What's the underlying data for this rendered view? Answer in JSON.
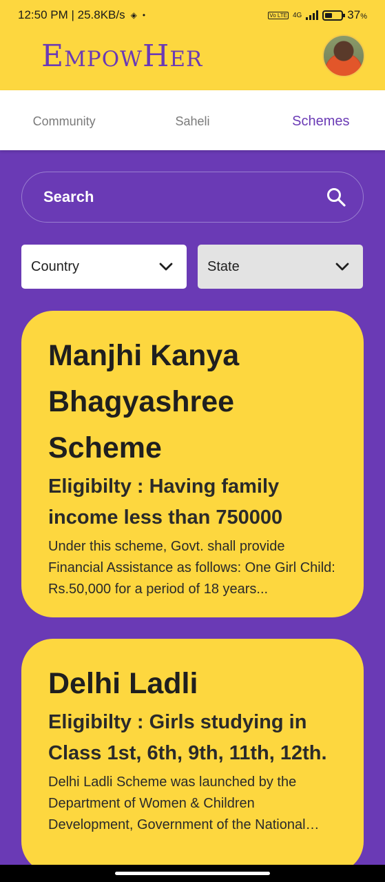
{
  "status": {
    "time_speed": "12:50 PM | 25.8KB/s",
    "battery": "37",
    "battery_unit": "%",
    "network": "4G",
    "volte": "Vo LTE"
  },
  "app": {
    "logo": "EmpowHer"
  },
  "tabs": [
    {
      "label": "Community"
    },
    {
      "label": "Saheli"
    },
    {
      "label": "Schemes"
    }
  ],
  "search": {
    "label": "Search"
  },
  "filters": {
    "country": "Country",
    "state": "State"
  },
  "schemes": [
    {
      "title": "Manjhi Kanya Bhagyashree Scheme",
      "eligibility": "Eligibilty : Having family income less than 750000",
      "description": "Under this scheme, Govt. shall provide Financial Assistance as follows: One Girl Child: Rs.50,000 for a period of 18 years..."
    },
    {
      "title": "Delhi Ladli",
      "eligibility": "Eligibilty : Girls studying in Class 1st, 6th, 9th, 11th, 12th.",
      "description": "Delhi Ladli Scheme was launched by the Department of Women & Children Development, Government of the National Capital Territory of Delhi..."
    }
  ],
  "colors": {
    "primary": "#6a3ab5",
    "accent": "#fdd73f"
  }
}
